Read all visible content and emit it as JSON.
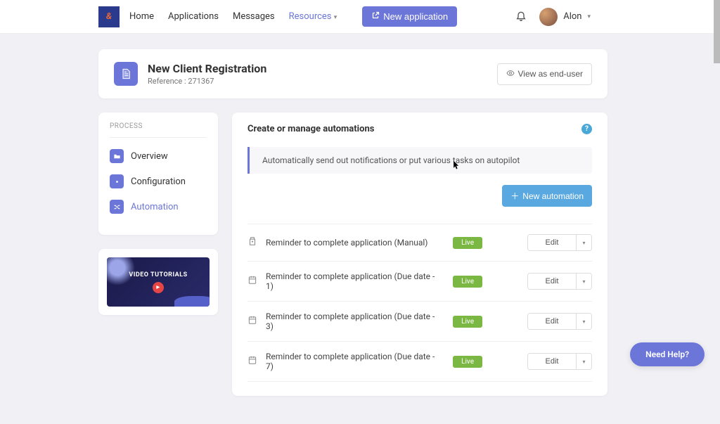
{
  "nav": {
    "items": [
      "Home",
      "Applications",
      "Messages",
      "Resources"
    ],
    "active_index": 3,
    "new_app_label": "New application"
  },
  "user": {
    "name": "Alon"
  },
  "header": {
    "title": "New Client Registration",
    "reference_label": "Reference : 271367",
    "view_btn": "View as end-user"
  },
  "sidebar": {
    "section_label": "PROCESS",
    "items": [
      {
        "label": "Overview"
      },
      {
        "label": "Configuration"
      },
      {
        "label": "Automation"
      }
    ],
    "active_index": 2
  },
  "tutorial": {
    "label": "VIDEO TUTORIALS"
  },
  "main": {
    "title": "Create or manage automations",
    "intro": "Automatically send out notifications or put various tasks on autopilot",
    "new_btn": "New automation",
    "edit_label": "Edit",
    "status_label": "Live",
    "automations": [
      {
        "type": "manual",
        "name": "Reminder to complete application (Manual)"
      },
      {
        "type": "date",
        "name": "Reminder to complete application (Due date - 1)"
      },
      {
        "type": "date",
        "name": "Reminder to complete application (Due date - 3)"
      },
      {
        "type": "date",
        "name": "Reminder to complete application (Due date - 7)"
      }
    ]
  },
  "need_help": "Need Help?",
  "colors": {
    "accent": "#6b76d8",
    "success": "#7bb843",
    "info": "#5aa8e0"
  }
}
